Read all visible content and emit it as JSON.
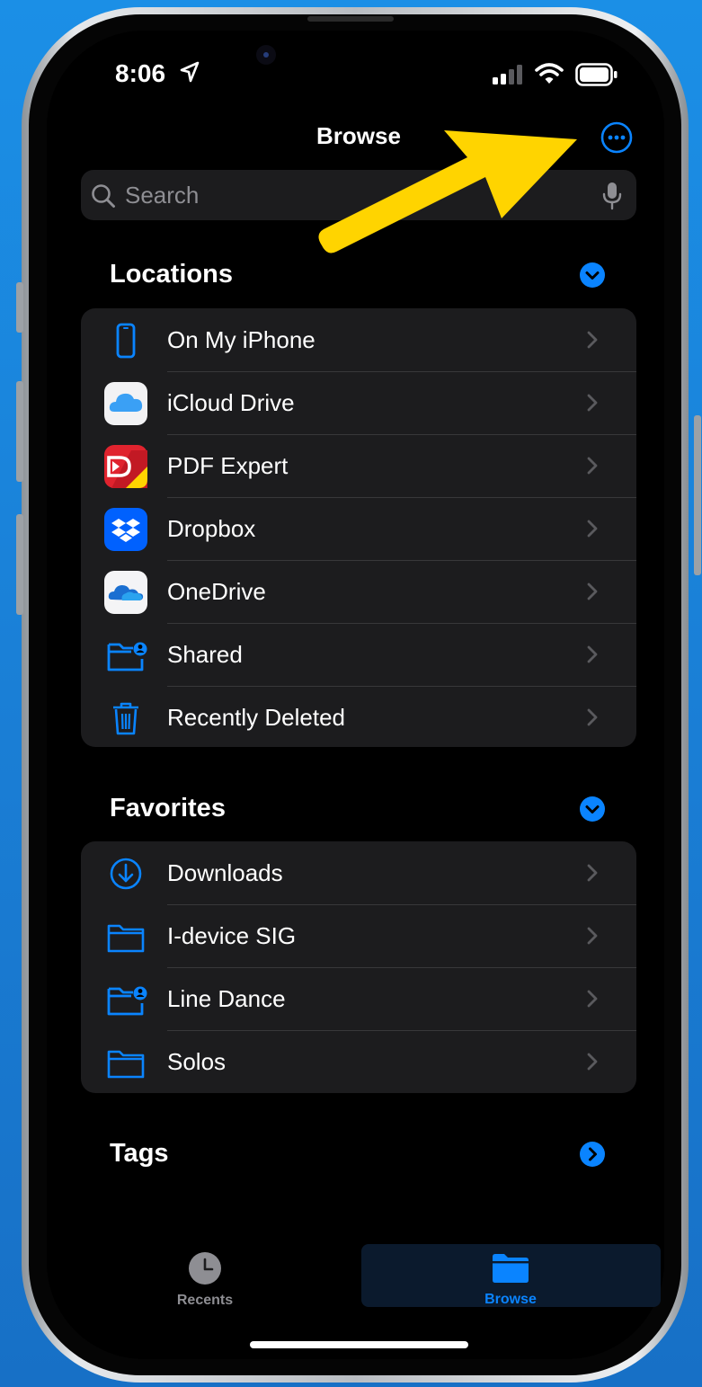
{
  "status_bar": {
    "time": "8:06"
  },
  "nav": {
    "title": "Browse"
  },
  "search": {
    "placeholder": "Search"
  },
  "locations": {
    "title": "Locations",
    "items": [
      {
        "label": "On My iPhone",
        "icon": "iphone-icon"
      },
      {
        "label": "iCloud Drive",
        "icon": "icloud-drive-icon"
      },
      {
        "label": "PDF Expert",
        "icon": "pdf-expert-icon"
      },
      {
        "label": "Dropbox",
        "icon": "dropbox-icon"
      },
      {
        "label": "OneDrive",
        "icon": "onedrive-icon"
      },
      {
        "label": "Shared",
        "icon": "shared-folder-icon"
      },
      {
        "label": "Recently Deleted",
        "icon": "trash-icon"
      }
    ]
  },
  "favorites": {
    "title": "Favorites",
    "items": [
      {
        "label": "Downloads",
        "icon": "downloads-icon"
      },
      {
        "label": "I-device SIG",
        "icon": "folder-icon"
      },
      {
        "label": "Line Dance",
        "icon": "shared-folder-icon"
      },
      {
        "label": "Solos",
        "icon": "folder-icon"
      }
    ]
  },
  "tags": {
    "title": "Tags"
  },
  "tab_bar": {
    "tabs": [
      {
        "label": "Recents",
        "icon": "clock-icon",
        "selected": false
      },
      {
        "label": "Browse",
        "icon": "folder-icon",
        "selected": true
      }
    ]
  },
  "colors": {
    "accent": "#0a84ff",
    "group_background": "#1c1c1e",
    "separator": "#38383a",
    "secondary_text": "#8e8e93",
    "annotation": "#ffd400",
    "outer_background": "#1a7fd6"
  }
}
